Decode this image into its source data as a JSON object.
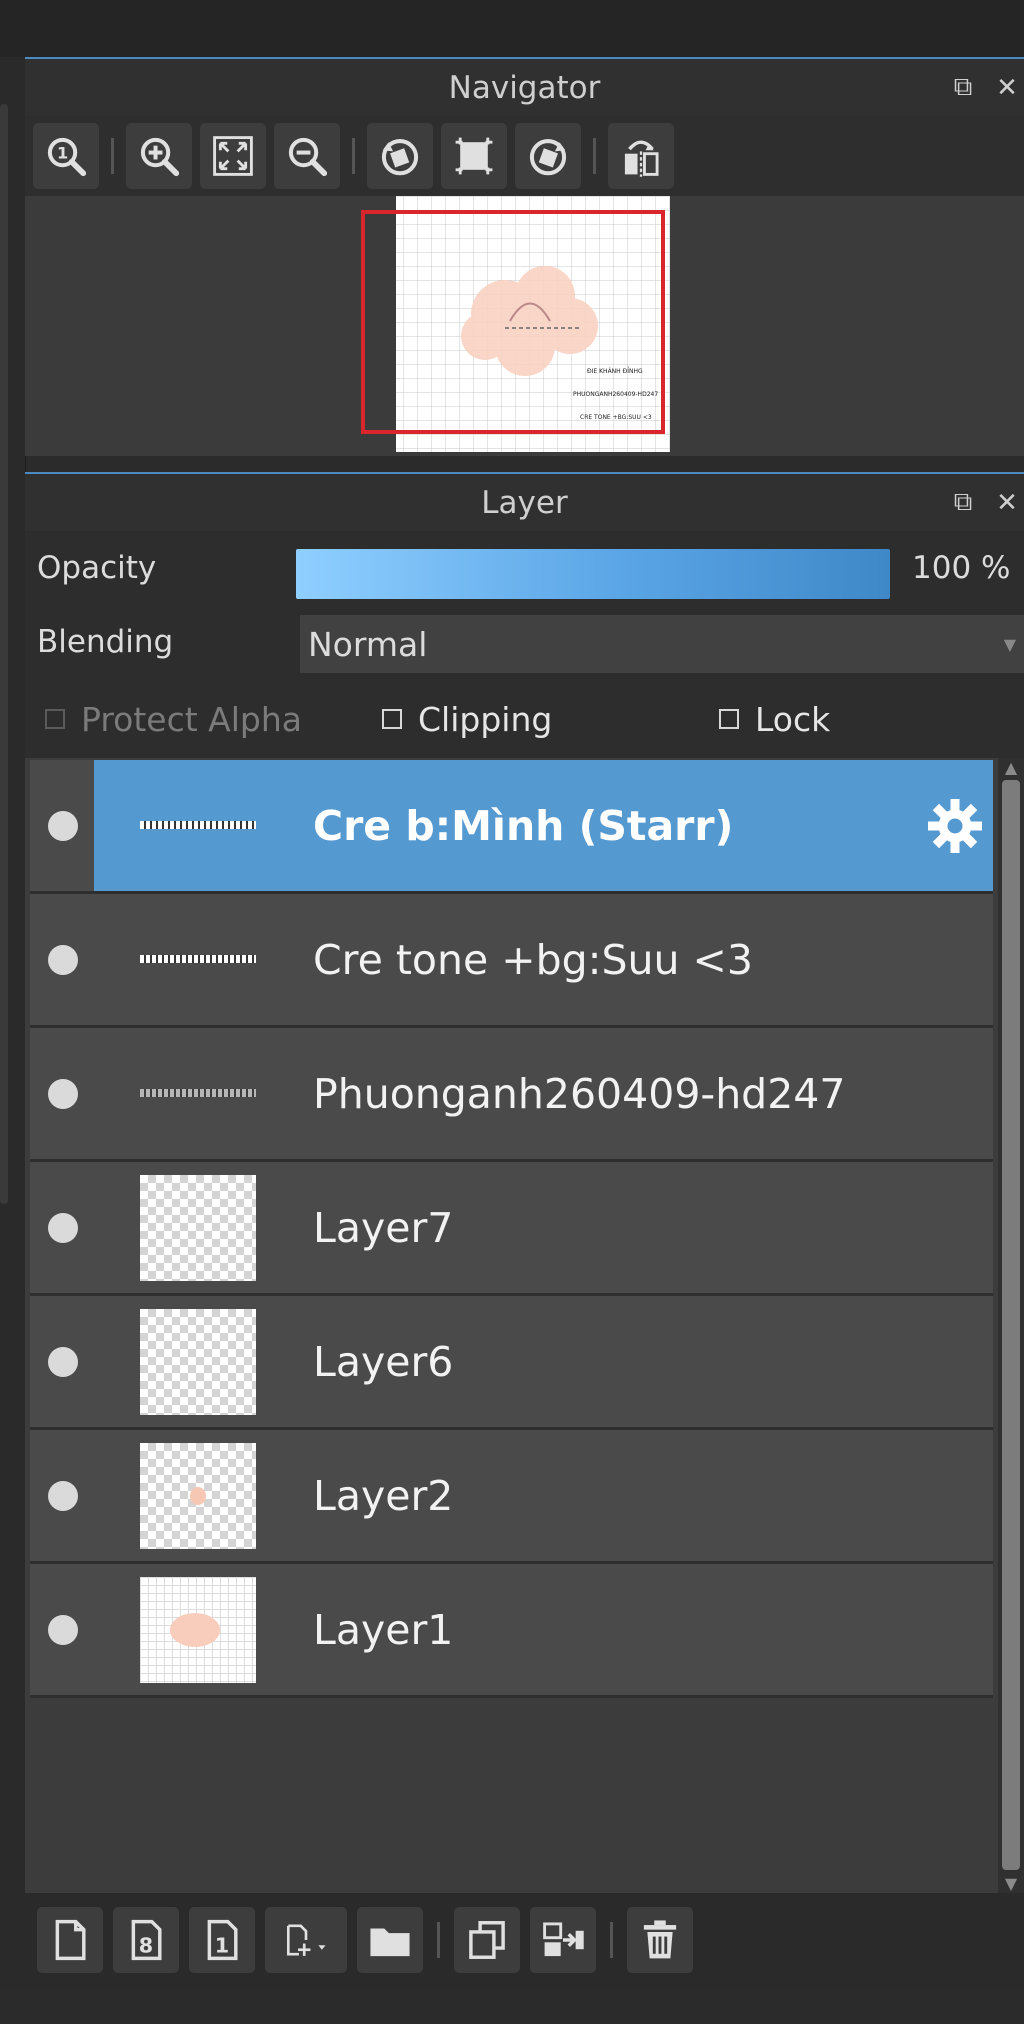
{
  "navigator": {
    "title": "Navigator",
    "toolbar_icons": [
      "zoom-actual-icon",
      "zoom-in-icon",
      "fit-screen-icon",
      "zoom-out-icon",
      "rotate-left-icon",
      "reset-rotation-icon",
      "rotate-right-icon",
      "flip-horizontal-icon"
    ],
    "preview_text_lines": [
      "ĐIE KHÁNH ĐỈNHG",
      "PHUONGANH260409-HD247",
      "CRE TONE +BG:SUU <3"
    ]
  },
  "layer_panel": {
    "title": "Layer",
    "opacity_label": "Opacity",
    "opacity_value": "100 %",
    "opacity_fraction": 1.0,
    "blending_label": "Blending",
    "blending_value": "Normal",
    "protect_alpha_label": "Protect Alpha",
    "clipping_label": "Clipping",
    "lock_label": "Lock",
    "layers": [
      {
        "name": "Cre b:Mình (Starr)",
        "active": true,
        "thumb": "text"
      },
      {
        "name": "Cre tone +bg:Suu <3",
        "active": false,
        "thumb": "text"
      },
      {
        "name": "Phuonganh260409-hd247",
        "active": false,
        "thumb": "text"
      },
      {
        "name": "Layer7",
        "active": false,
        "thumb": "checker"
      },
      {
        "name": "Layer6",
        "active": false,
        "thumb": "checker"
      },
      {
        "name": "Layer2",
        "active": false,
        "thumb": "checker-dot"
      },
      {
        "name": "Layer1",
        "active": false,
        "thumb": "grid-flower"
      }
    ],
    "bottom_icons": [
      "new-layer-icon",
      "new-8bit-layer-icon",
      "new-1bit-layer-icon",
      "add-layer-menu-icon",
      "new-folder-icon",
      "duplicate-layer-icon",
      "merge-down-icon",
      "delete-layer-icon"
    ]
  },
  "colors": {
    "accent": "#5599d1",
    "panel_border": "#4c8bc0",
    "nav_frame": "#d9262c"
  }
}
